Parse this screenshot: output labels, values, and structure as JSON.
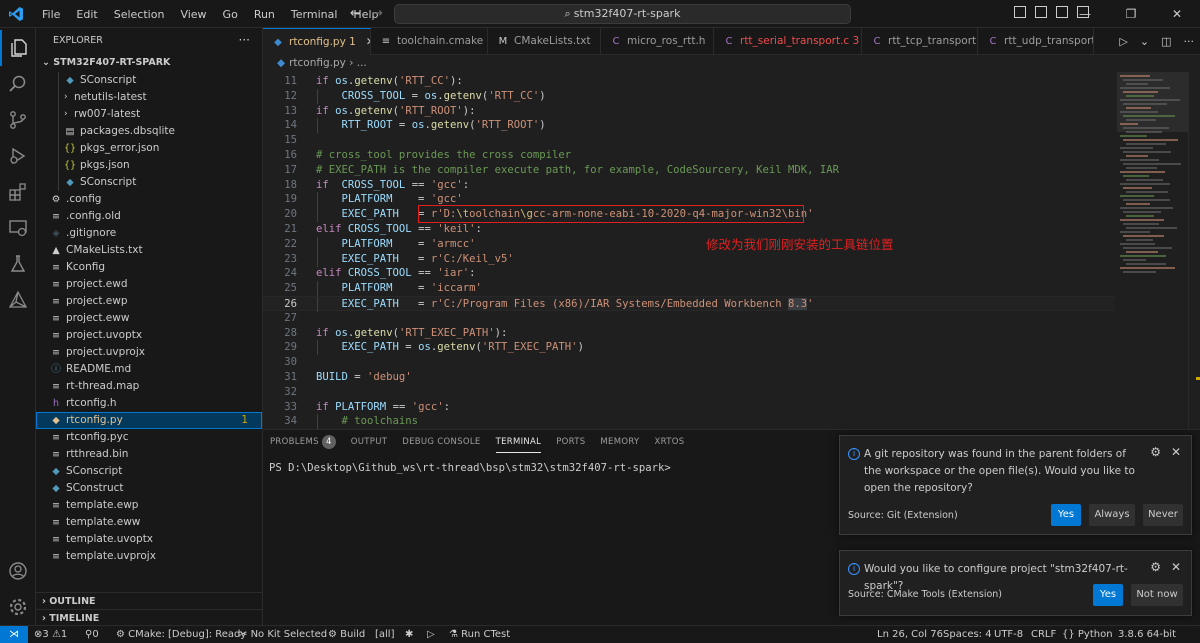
{
  "titlebar": {
    "menu": [
      "File",
      "Edit",
      "Selection",
      "View",
      "Go",
      "Run",
      "Terminal",
      "Help"
    ],
    "search": "stm32f407-rt-spark"
  },
  "sidebar": {
    "header": "EXPLORER",
    "folder": "STM32F407-RT-SPARK",
    "items": [
      {
        "label": "SConscript",
        "icon": "python-icon",
        "chev": "",
        "color": "#519aba",
        "badge": ""
      },
      {
        "label": "netutils-latest",
        "icon": "",
        "chev": "›",
        "color": "#cccccc",
        "badge": ""
      },
      {
        "label": "rw007-latest",
        "icon": "",
        "chev": "›",
        "color": "#cccccc",
        "badge": ""
      },
      {
        "label": "packages.dbsqlite",
        "icon": "database-icon",
        "chev": "",
        "color": "#cccccc",
        "badge": ""
      },
      {
        "label": "pkgs_error.json",
        "icon": "json-icon",
        "chev": "",
        "color": "#cbcb41",
        "badge": ""
      },
      {
        "label": "pkgs.json",
        "icon": "json-icon",
        "chev": "",
        "color": "#cbcb41",
        "badge": ""
      },
      {
        "label": "SConscript",
        "icon": "python-icon",
        "chev": "",
        "color": "#519aba",
        "badge": ""
      },
      {
        "label": ".config",
        "icon": "settings-icon",
        "chev": "",
        "color": "#cccccc",
        "badge": ""
      },
      {
        "label": ".config.old",
        "icon": "file-icon",
        "chev": "",
        "color": "#cccccc",
        "badge": ""
      },
      {
        "label": ".gitignore",
        "icon": "git-icon",
        "chev": "",
        "color": "#41535b",
        "badge": ""
      },
      {
        "label": "CMakeLists.txt",
        "icon": "cmake-icon",
        "chev": "",
        "color": "#cccccc",
        "badge": ""
      },
      {
        "label": "Kconfig",
        "icon": "file-icon",
        "chev": "",
        "color": "#cccccc",
        "badge": ""
      },
      {
        "label": "project.ewd",
        "icon": "file-icon",
        "chev": "",
        "color": "#cccccc",
        "badge": ""
      },
      {
        "label": "project.ewp",
        "icon": "file-icon",
        "chev": "",
        "color": "#cccccc",
        "badge": ""
      },
      {
        "label": "project.eww",
        "icon": "file-icon",
        "chev": "",
        "color": "#cccccc",
        "badge": ""
      },
      {
        "label": "project.uvoptx",
        "icon": "file-icon",
        "chev": "",
        "color": "#cccccc",
        "badge": ""
      },
      {
        "label": "project.uvprojx",
        "icon": "file-icon",
        "chev": "",
        "color": "#cccccc",
        "badge": ""
      },
      {
        "label": "README.md",
        "icon": "info-icon",
        "chev": "",
        "color": "#519aba",
        "badge": ""
      },
      {
        "label": "rt-thread.map",
        "icon": "file-icon",
        "chev": "",
        "color": "#cccccc",
        "badge": ""
      },
      {
        "label": "rtconfig.h",
        "icon": "c-header-icon",
        "chev": "",
        "color": "#a074c4",
        "badge": ""
      },
      {
        "label": "rtconfig.py",
        "icon": "python-icon",
        "chev": "",
        "color": "#e2c08d",
        "badge": "1"
      },
      {
        "label": "rtconfig.pyc",
        "icon": "file-icon",
        "chev": "",
        "color": "#cccccc",
        "badge": ""
      },
      {
        "label": "rtthread.bin",
        "icon": "file-icon",
        "chev": "",
        "color": "#cccccc",
        "badge": ""
      },
      {
        "label": "SConscript",
        "icon": "python-icon",
        "chev": "",
        "color": "#519aba",
        "badge": ""
      },
      {
        "label": "SConstruct",
        "icon": "python-icon",
        "chev": "",
        "color": "#519aba",
        "badge": ""
      },
      {
        "label": "template.ewp",
        "icon": "file-icon",
        "chev": "",
        "color": "#cccccc",
        "badge": ""
      },
      {
        "label": "template.eww",
        "icon": "file-icon",
        "chev": "",
        "color": "#cccccc",
        "badge": ""
      },
      {
        "label": "template.uvoptx",
        "icon": "file-icon",
        "chev": "",
        "color": "#cccccc",
        "badge": ""
      },
      {
        "label": "template.uvprojx",
        "icon": "file-icon",
        "chev": "",
        "color": "#cccccc",
        "badge": ""
      }
    ],
    "outline": "OUTLINE",
    "timeline": "TIMELINE"
  },
  "tabs": [
    {
      "label": "rtconfig.py",
      "suffix": "1",
      "icon": "python-icon",
      "active": true
    },
    {
      "label": "toolchain.cmake",
      "suffix": "",
      "icon": "lines-icon",
      "active": false
    },
    {
      "label": "CMakeLists.txt",
      "suffix": "",
      "icon": "cmake-icon",
      "active": false
    },
    {
      "label": "micro_ros_rtt.h",
      "suffix": "",
      "icon": "c-header-icon",
      "active": false
    },
    {
      "label": "rtt_serial_transport.c",
      "suffix": "3",
      "icon": "c-icon",
      "active": false
    },
    {
      "label": "rtt_tcp_transport.c",
      "suffix": "",
      "icon": "c-icon",
      "active": false
    },
    {
      "label": "rtt_udp_transport.c",
      "suffix": "",
      "icon": "c-icon",
      "active": false
    }
  ],
  "breadcrumb": {
    "file": "rtconfig.py",
    "rest": "..."
  },
  "editor": {
    "lines": [
      {
        "n": "11",
        "html": "<span class=\"tk-kw\">if</span> <span class=\"tk-var\">os</span>.<span class=\"tk-fn\">getenv</span>(<span class=\"tk-str\">'RTT_CC'</span>):"
      },
      {
        "n": "12",
        "html": "    <span class=\"tk-var\">CROSS_TOOL</span> = <span class=\"tk-var\">os</span>.<span class=\"tk-fn\">getenv</span>(<span class=\"tk-str\">'RTT_CC'</span>)"
      },
      {
        "n": "13",
        "html": "<span class=\"tk-kw\">if</span> <span class=\"tk-var\">os</span>.<span class=\"tk-fn\">getenv</span>(<span class=\"tk-str\">'RTT_ROOT'</span>):"
      },
      {
        "n": "14",
        "html": "    <span class=\"tk-var\">RTT_ROOT</span> = <span class=\"tk-var\">os</span>.<span class=\"tk-fn\">getenv</span>(<span class=\"tk-str\">'RTT_ROOT'</span>)"
      },
      {
        "n": "15",
        "html": ""
      },
      {
        "n": "16",
        "html": "<span class=\"tk-com\"># cross_tool provides the cross compiler</span>"
      },
      {
        "n": "17",
        "html": "<span class=\"tk-com\"># EXEC_PATH is the compiler execute path, for example, CodeSourcery, Keil MDK, IAR</span>"
      },
      {
        "n": "18",
        "html": "<span class=\"tk-kw\">if</span>  <span class=\"tk-var\">CROSS_TOOL</span> == <span class=\"tk-str\">'gcc'</span>:"
      },
      {
        "n": "19",
        "html": "    <span class=\"tk-var\">PLATFORM</span>    = <span class=\"tk-str\">'gcc'</span>"
      },
      {
        "n": "20",
        "html": "    <span class=\"tk-var\">EXEC_PATH</span>   = <span class=\"tk-str\">r'D:<span class=\"tk-esc\">\\t</span>oolchain<span class=\"tk-esc\">\\g</span>cc-arm-none-eabi-10-2020-q4-major-win32\\bin'</span>"
      },
      {
        "n": "21",
        "html": "<span class=\"tk-kw\">elif</span> <span class=\"tk-var\">CROSS_TOOL</span> == <span class=\"tk-str\">'keil'</span>:"
      },
      {
        "n": "22",
        "html": "    <span class=\"tk-var\">PLATFORM</span>    = <span class=\"tk-str\">'armcc'</span>"
      },
      {
        "n": "23",
        "html": "    <span class=\"tk-var\">EXEC_PATH</span>   = <span class=\"tk-str\">r'C:/Keil_v5'</span>"
      },
      {
        "n": "24",
        "html": "<span class=\"tk-kw\">elif</span> <span class=\"tk-var\">CROSS_TOOL</span> == <span class=\"tk-str\">'iar'</span>:"
      },
      {
        "n": "25",
        "html": "    <span class=\"tk-var\">PLATFORM</span>    = <span class=\"tk-str\">'iccarm'</span>"
      },
      {
        "n": "26",
        "html": "    <span class=\"tk-var\">EXEC_PATH</span>   = <span class=\"tk-str\">r'C:/Program Files (x86)/IAR Systems/Embedded Workbench <span class=\"tk-hl\">8.3</span>'</span>"
      },
      {
        "n": "27",
        "html": ""
      },
      {
        "n": "28",
        "html": "<span class=\"tk-kw\">if</span> <span class=\"tk-var\">os</span>.<span class=\"tk-fn\">getenv</span>(<span class=\"tk-str\">'RTT_EXEC_PATH'</span>):"
      },
      {
        "n": "29",
        "html": "    <span class=\"tk-var\">EXEC_PATH</span> = <span class=\"tk-var\">os</span>.<span class=\"tk-fn\">getenv</span>(<span class=\"tk-str\">'RTT_EXEC_PATH'</span>)"
      },
      {
        "n": "30",
        "html": ""
      },
      {
        "n": "31",
        "html": "<span class=\"tk-var\">BUILD</span> = <span class=\"tk-str\">'debug'</span>"
      },
      {
        "n": "32",
        "html": ""
      },
      {
        "n": "33",
        "html": "<span class=\"tk-kw\">if</span> <span class=\"tk-var\">PLATFORM</span> == <span class=\"tk-str\">'gcc'</span>:"
      },
      {
        "n": "34",
        "html": "    <span class=\"tk-com\"># toolchains</span>"
      }
    ],
    "annotation": "修改为我们刚刚安装的工具链位置"
  },
  "panel": {
    "tabs": [
      {
        "label": "PROBLEMS",
        "count": "4"
      },
      {
        "label": "OUTPUT",
        "count": ""
      },
      {
        "label": "DEBUG CONSOLE",
        "count": ""
      },
      {
        "label": "TERMINAL",
        "count": ""
      },
      {
        "label": "PORTS",
        "count": ""
      },
      {
        "label": "MEMORY",
        "count": ""
      },
      {
        "label": "XRTOS",
        "count": ""
      }
    ],
    "terminal": "PS D:\\Desktop\\Github_ws\\rt-thread\\bsp\\stm32\\stm32f407-rt-spark>"
  },
  "notifications": {
    "git": {
      "message": "A git repository was found in the parent folders of the workspace or the open file(s). Would you like to open the repository?",
      "source": "Source: Git (Extension)",
      "yes": "Yes",
      "always": "Always",
      "never": "Never"
    },
    "cmake": {
      "message": "Would you like to configure project \"stm32f407-rt-spark\"?",
      "source": "Source: CMake Tools (Extension)",
      "yes": "Yes",
      "not_now": "Not now"
    }
  },
  "statusbar": {
    "errors": "3",
    "warnings": "1",
    "ports": "0",
    "cmake": "CMake: [Debug]: Ready",
    "kit": "No Kit Selected",
    "build": "Build",
    "target": "[all]",
    "run_ctest": "Run CTest",
    "position": "Ln 26, Col 76",
    "spaces": "Spaces: 4",
    "encoding": "UTF-8",
    "eol": "CRLF",
    "language": "Python",
    "interpreter": "3.8.6 64-bit"
  },
  "colors": {
    "accent": "#0078d4",
    "annotation": "#e02020",
    "warning": "#cca700"
  }
}
